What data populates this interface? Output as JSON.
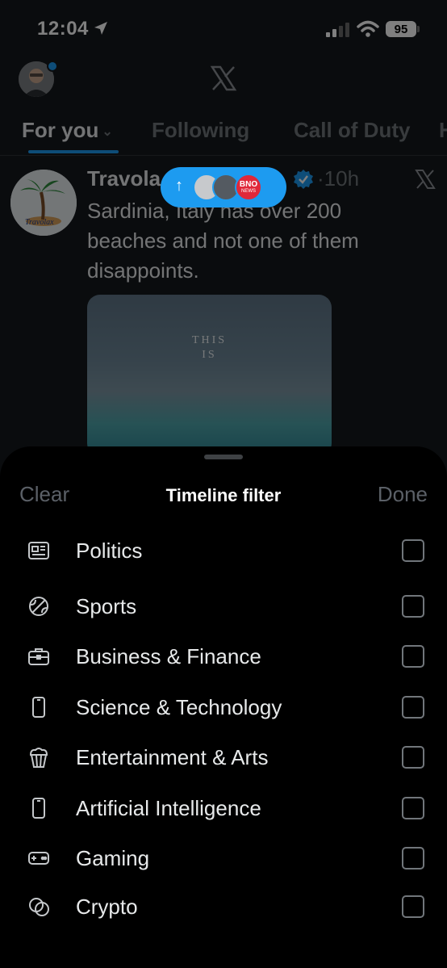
{
  "status_bar": {
    "time": "12:04",
    "battery": "95"
  },
  "tabs": [
    {
      "label": "For you",
      "active": true
    },
    {
      "label": "Following",
      "active": false
    },
    {
      "label": "Call of Duty",
      "active": false
    },
    {
      "label": "H",
      "active": false
    }
  ],
  "post": {
    "author": "Travola",
    "time": "·10h",
    "text": "Sardinia, Italy has over 200 beaches and not one of them disappoints.",
    "image_caption_line1": "THIS",
    "image_caption_line2": "IS",
    "avatar_text": "Travolax"
  },
  "new_posts_pill": {
    "arrow": "↑",
    "badge": "BNO",
    "badge_sub": "NEWS"
  },
  "sheet": {
    "clear_label": "Clear",
    "title": "Timeline filter",
    "done_label": "Done",
    "items": [
      {
        "label": "Politics",
        "icon": "newspaper-icon",
        "checked": false
      },
      {
        "label": "Sports",
        "icon": "ball-icon",
        "checked": false
      },
      {
        "label": "Business & Finance",
        "icon": "briefcase-icon",
        "checked": false
      },
      {
        "label": "Science & Technology",
        "icon": "phone-icon",
        "checked": false
      },
      {
        "label": "Entertainment & Arts",
        "icon": "popcorn-icon",
        "checked": false
      },
      {
        "label": "Artificial Intelligence",
        "icon": "phone-icon",
        "checked": false
      },
      {
        "label": "Gaming",
        "icon": "gamepad-icon",
        "checked": false
      },
      {
        "label": "Crypto",
        "icon": "coins-icon",
        "checked": false
      }
    ]
  },
  "colors": {
    "accent": "#1d9bf0",
    "background": "#15181c",
    "sheet": "#000000",
    "muted": "#71767b"
  }
}
